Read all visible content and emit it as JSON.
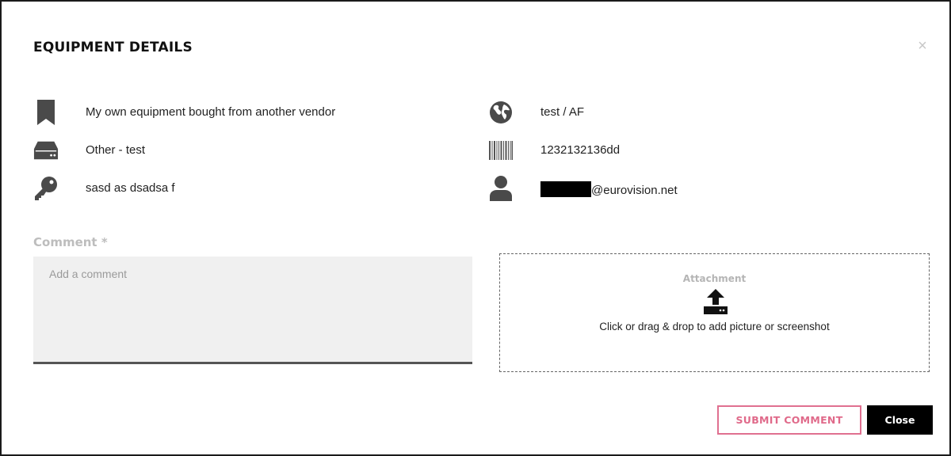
{
  "dialog": {
    "title": "EQUIPMENT DETAILS",
    "close_icon": "×"
  },
  "details": {
    "left": [
      {
        "icon": "bookmark-icon",
        "text": "My own equipment bought from another vendor"
      },
      {
        "icon": "hard-drive-icon",
        "text": "Other - test"
      },
      {
        "icon": "key-icon",
        "text": "sasd as dsadsa f"
      }
    ],
    "right": [
      {
        "icon": "globe-icon",
        "text": "test / AF"
      },
      {
        "icon": "barcode-icon",
        "text": "1232132136dd"
      },
      {
        "icon": "user-icon",
        "text": "@eurovision.net"
      }
    ]
  },
  "comment": {
    "label": "Comment *",
    "placeholder": "Add a comment",
    "value": ""
  },
  "attachment": {
    "title": "Attachment",
    "icon": "upload-icon",
    "hint": "Click or drag & drop to add picture or screenshot"
  },
  "actions": {
    "submit_label": "SUBMIT COMMENT",
    "close_label": "Close"
  },
  "colors": {
    "accent_pink": "#e06a8a",
    "icon_gray": "#4a4a4a",
    "close_bg": "#000000"
  }
}
